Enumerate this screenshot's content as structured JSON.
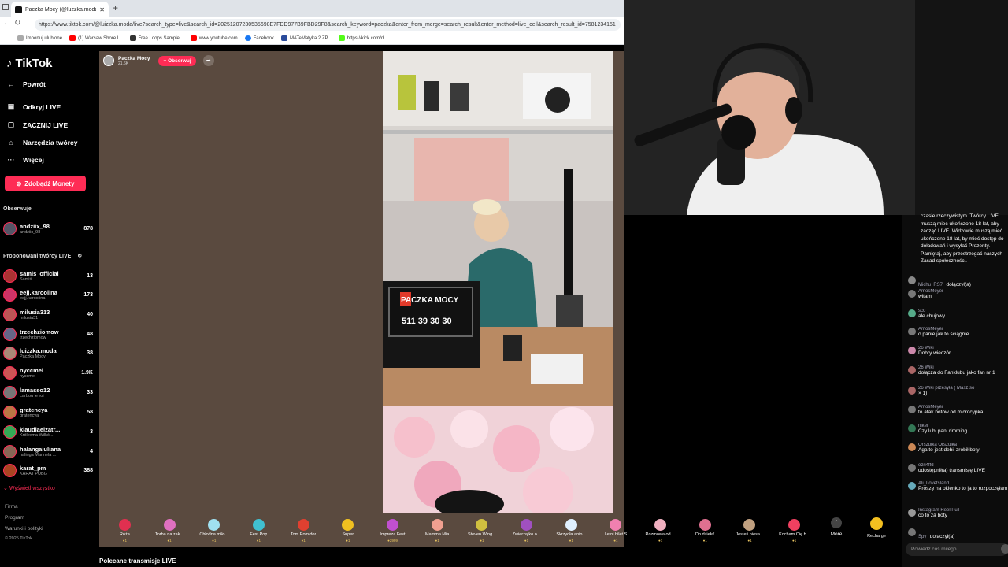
{
  "browser": {
    "tab_title": "Paczka Mocy (@luzzka.moda",
    "url": "https://www.tiktok.com/@luizzka.moda/live?search_type=live&search_id=20251207230535698E7FDD977B9FBD29F8&search_keyword=paczka&enter_from_merge=search_result&enter_method=live_cell&search_result_id=7581234151",
    "bookmarks": [
      "Importuj ulubione",
      "(1) Warsaw Shore I...",
      "Free Loops Sample...",
      "www.youtube.com",
      "Facebook",
      "MATeMatyka 2 ZP...",
      "https://kick.com/d..."
    ]
  },
  "sidebar": {
    "logo": "TikTok",
    "back": "Powrót",
    "nav": [
      {
        "label": "Odkryj LIVE",
        "icon": "live-tv-icon"
      },
      {
        "label": "ZACZNIJ LIVE",
        "icon": "camera-icon"
      },
      {
        "label": "Narzędzia twórcy",
        "icon": "lightbulb-icon"
      },
      {
        "label": "Więcej",
        "icon": "more-dots-icon"
      }
    ],
    "coins_button": "Zdobądź Monety",
    "following_header": "Obserwuje",
    "following": [
      {
        "name": "andziix_98",
        "sub": "andziix_98",
        "count": "878"
      }
    ],
    "suggested_header": "Proponowani twórcy LIVE",
    "suggested": [
      {
        "name": "samis_official",
        "sub": "Samiś",
        "count": "13"
      },
      {
        "name": "eejj.karoolina",
        "sub": "eejj.karoolina",
        "count": "173"
      },
      {
        "name": "milusia313",
        "sub": "milusia31",
        "count": "40"
      },
      {
        "name": "trzechziomow",
        "sub": "trzechziomow",
        "count": "48"
      },
      {
        "name": "luizzka.moda",
        "sub": "Paczka Mocy",
        "count": "38"
      },
      {
        "name": "nyccmel",
        "sub": "nyccmel",
        "count": "1.9K"
      },
      {
        "name": "lamasso12",
        "sub": "Larbou le roi",
        "count": "33"
      },
      {
        "name": "gratencya",
        "sub": "gratencya",
        "count": "58"
      },
      {
        "name": "klaudiaelzatr...",
        "sub": "Królewna Wilkó...",
        "count": "3"
      },
      {
        "name": "halangaiuliana",
        "sub": "halinga Marinela ...",
        "count": "4"
      },
      {
        "name": "karat_pm",
        "sub": "KARAT PUBG",
        "count": "388"
      }
    ],
    "see_all": "Wyświetl wszystko",
    "footer": [
      "Firma",
      "Program",
      "Warunki i polityki",
      "© 2025 TikTok"
    ]
  },
  "live": {
    "host_name": "Paczka Mocy",
    "viewers": "21.6K",
    "follow_label": "+ Obserwuj",
    "sign_brand": "PACZKA MOCY",
    "sign_phone": "511 39 30 30",
    "recommended": "Polecane transmisje LIVE"
  },
  "gifts": [
    {
      "name": "Róża",
      "price": "1",
      "color": "#e03050"
    },
    {
      "name": "Torba na zak...",
      "price": "1",
      "color": "#e070c0"
    },
    {
      "name": "Chłodna miło...",
      "price": "1",
      "color": "#a0e0f0"
    },
    {
      "name": "Fest Pop",
      "price": "1",
      "color": "#40c0d0"
    },
    {
      "name": "Tom Pomidor",
      "price": "1",
      "color": "#e04030"
    },
    {
      "name": "Super",
      "price": "1",
      "color": "#f0c020"
    },
    {
      "name": "Impreza Fest",
      "price": "2999",
      "color": "#c050d0"
    },
    {
      "name": "Mamma Mia",
      "price": "1",
      "color": "#f0a090"
    },
    {
      "name": "Steven Wing...",
      "price": "1",
      "color": "#d0c040"
    },
    {
      "name": "Zwierzątko o...",
      "price": "1",
      "color": "#a050c0"
    },
    {
      "name": "Skrzydła anio...",
      "price": "1",
      "color": "#e0f0ff"
    },
    {
      "name": "Letni bilet S",
      "price": "1",
      "color": "#f080b0"
    },
    {
      "name": "Rozmowa od ...",
      "price": "1",
      "color": "#f0b0c0"
    },
    {
      "name": "Do dzieła!",
      "price": "1",
      "color": "#e07090"
    },
    {
      "name": "Jesteś niesa...",
      "price": "1",
      "color": "#c0a080"
    },
    {
      "name": "Kocham Cię b...",
      "price": "1",
      "color": "#f04060"
    }
  ],
  "gift_more": "More",
  "gift_recharge": "Recharge",
  "chat": {
    "rules": "czasie rzeczywistym. Twórcy LIVE muszą mieć ukończone 18 lat, aby zacząć LIVE. Widzowie muszą mieć ukończone 18 lat, by mieć dostęp do doładowań i wysyłać Prezenty. Pamiętaj, aby przestrzegać naszych Zasad społeczności.",
    "messages": [
      {
        "user": "Michu_RS7",
        "text": "dołączył(a)",
        "inline": true
      },
      {
        "user": "AmosMeyer",
        "text": "witam"
      },
      {
        "user": "sco",
        "text": "ale chujowy"
      },
      {
        "user": "AmosMeyer",
        "text": "o panie jak to ściągnie"
      },
      {
        "user": "26 Wiki",
        "text": "Dobry wieczór"
      },
      {
        "user": "26 Wiki",
        "text": "dołącza do Fanklubu jako fan nr 1"
      },
      {
        "user": "26 Wiki przesyła ( Masz so",
        "text": "× 1)"
      },
      {
        "user": "AmosMeyer",
        "text": "to atak botów od microcypka"
      },
      {
        "user": "niker",
        "text": "Czy lubi pani rimming"
      },
      {
        "user": "Orszulka Orszulka",
        "text": "Aga to jest debil zrobił boty"
      },
      {
        "user": "ezri4ffd",
        "text": "udostępnił(a) transmisję LIVE"
      },
      {
        "user": "Ali_Lovetsland",
        "text": "Proszę na okienko to ja to rozpoczęłam"
      },
      {
        "user": "Instagram Reel Pull",
        "text": "co to za boty"
      },
      {
        "user": "Spy",
        "text": "dołączył(a)",
        "inline": true
      }
    ],
    "input_placeholder": "Powiedz coś miłego"
  }
}
